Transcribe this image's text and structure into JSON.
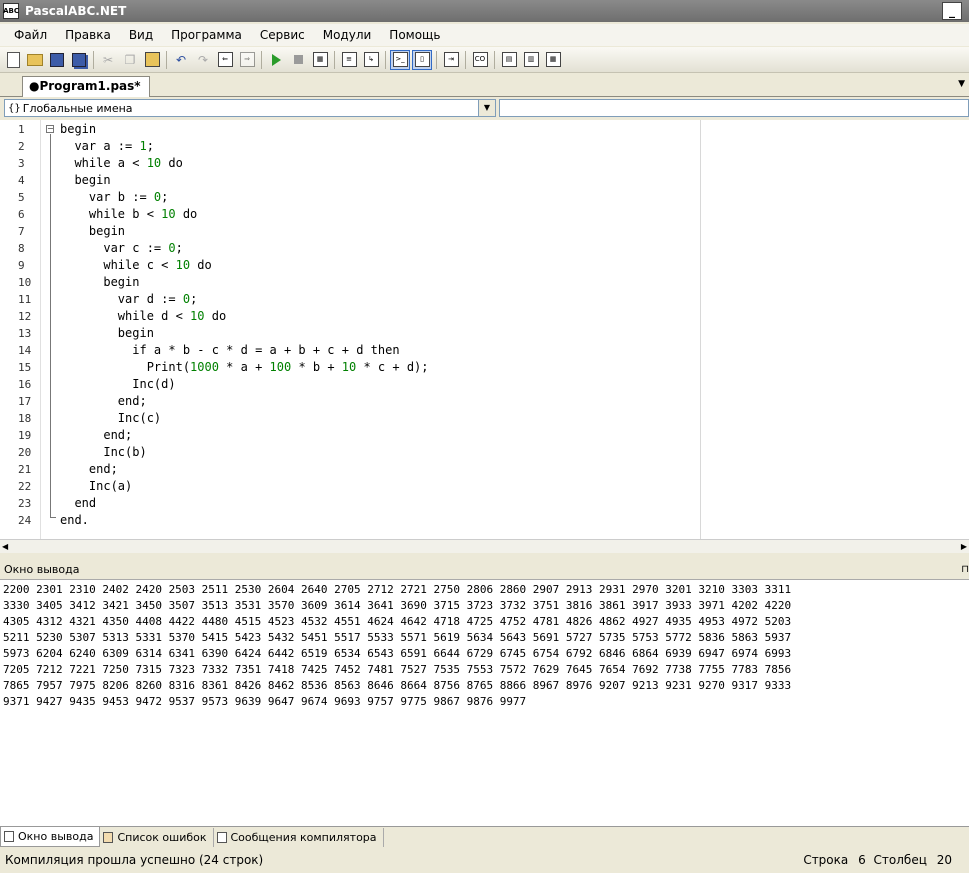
{
  "window": {
    "title": "PascalABC.NET",
    "icon_text": "ABC"
  },
  "menu": [
    "Файл",
    "Правка",
    "Вид",
    "Программа",
    "Сервис",
    "Модули",
    "Помощь"
  ],
  "toolbar": {
    "icons": [
      "new-file-icon",
      "open-folder-icon",
      "save-icon",
      "save-all-icon",
      "cut-icon",
      "copy-icon",
      "paste-icon",
      "undo-icon",
      "redo-icon",
      "step-back-icon",
      "step-forward-icon",
      "run-icon",
      "stop-icon",
      "compile-icon",
      "debug-step-icon",
      "debug-step-over-icon",
      "toggle-console-icon",
      "toggle-split-icon",
      "navigate-icon",
      "code-icon",
      "designer-icon",
      "form-icon",
      "grid-icon"
    ]
  },
  "tabs": [
    {
      "label": "●Program1.pas*"
    }
  ],
  "scope": {
    "selected": "Глобальные имена",
    "braces": "{}"
  },
  "editor": {
    "line_numbers": [
      "1",
      "2",
      "3",
      "4",
      "5",
      "6",
      "7",
      "8",
      "9",
      "10",
      "11",
      "12",
      "13",
      "14",
      "15",
      "16",
      "17",
      "18",
      "19",
      "20",
      "21",
      "22",
      "23",
      "24"
    ],
    "lines": [
      "begin",
      "  var a := 1;",
      "  while a < 10 do",
      "  begin",
      "    var b := 0;",
      "    while b < 10 do",
      "    begin",
      "      var c := 0;",
      "      while c < 10 do",
      "      begin",
      "        var d := 0;",
      "        while d < 10 do",
      "        begin",
      "          if a * b - c * d = a + b + c + d then",
      "            Print(1000 * a + 100 * b + 10 * c + d);",
      "          Inc(d)",
      "        end;",
      "        Inc(c)",
      "      end;",
      "      Inc(b)",
      "    end;",
      "    Inc(a)",
      "  end",
      "end."
    ]
  },
  "output_panel": {
    "title": "Окно вывода",
    "lines": [
      "2200 2301 2310 2402 2420 2503 2511 2530 2604 2640 2705 2712 2721 2750 2806 2860 2907 2913 2931 2970 3201 3210 3303 3311",
      "3330 3405 3412 3421 3450 3507 3513 3531 3570 3609 3614 3641 3690 3715 3723 3732 3751 3816 3861 3917 3933 3971 4202 4220",
      "4305 4312 4321 4350 4408 4422 4480 4515 4523 4532 4551 4624 4642 4718 4725 4752 4781 4826 4862 4927 4935 4953 4972 5203",
      "5211 5230 5307 5313 5331 5370 5415 5423 5432 5451 5517 5533 5571 5619 5634 5643 5691 5727 5735 5753 5772 5836 5863 5937",
      "5973 6204 6240 6309 6314 6341 6390 6424 6442 6519 6534 6543 6591 6644 6729 6745 6754 6792 6846 6864 6939 6947 6974 6993",
      "7205 7212 7221 7250 7315 7323 7332 7351 7418 7425 7452 7481 7527 7535 7553 7572 7629 7645 7654 7692 7738 7755 7783 7856",
      "7865 7957 7975 8206 8260 8316 8361 8426 8462 8536 8563 8646 8664 8756 8765 8866 8967 8976 9207 9213 9231 9270 9317 9333",
      "9371 9427 9435 9453 9472 9537 9573 9639 9647 9674 9693 9757 9775 9867 9876 9977"
    ]
  },
  "bottom_tabs": [
    {
      "label": "Окно вывода",
      "icon": "output-window-icon"
    },
    {
      "label": "Список ошибок",
      "icon": "error-list-icon"
    },
    {
      "label": "Сообщения компилятора",
      "icon": "compiler-messages-icon"
    }
  ],
  "status": {
    "message": "Компиляция прошла успешно (24 строк)",
    "row_label": "Строка",
    "row": "6",
    "col_label": "Столбец",
    "col": "20"
  },
  "colors": {
    "number": "#008000",
    "titlebar": "#7a7a7a",
    "background": "#ece9d8"
  }
}
